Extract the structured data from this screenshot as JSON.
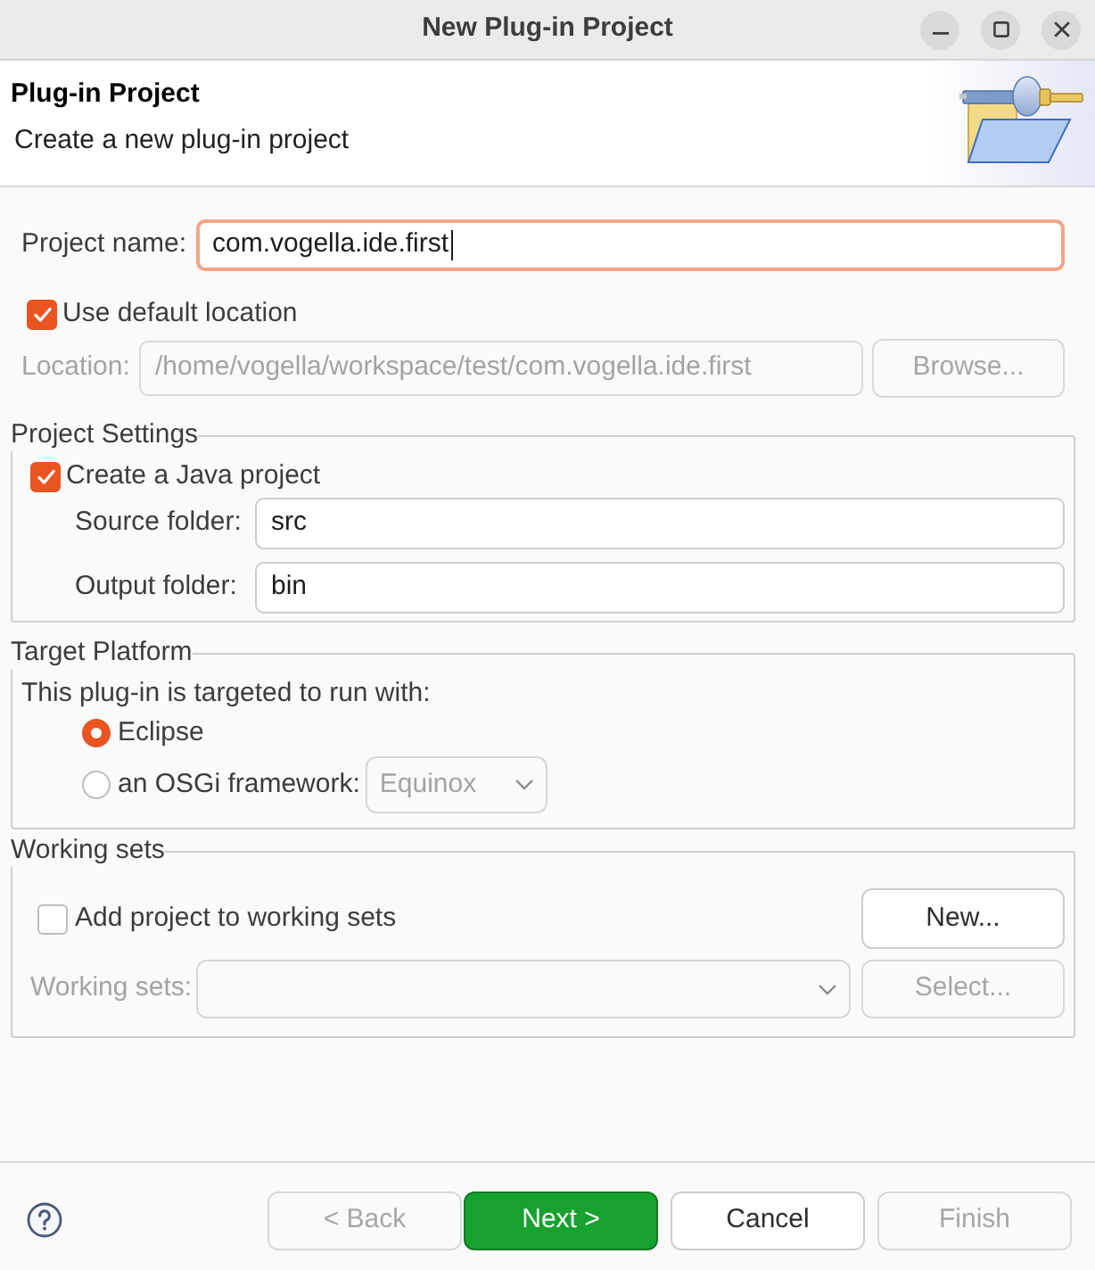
{
  "window": {
    "title": "New Plug-in Project"
  },
  "banner": {
    "title": "Plug-in Project",
    "description": "Create a new plug-in project"
  },
  "project_name": {
    "label": "Project name:",
    "value": "com.vogella.ide.first",
    "focused": true
  },
  "use_default_location": {
    "label": "Use default location",
    "checked": true
  },
  "location": {
    "label": "Location:",
    "value": "/home/vogella/workspace/test/com.vogella.ide.first",
    "disabled": true,
    "browse_button": {
      "label": "Browse...",
      "disabled": true
    }
  },
  "project_settings": {
    "title": "Project Settings",
    "create_java_project": {
      "label": "Create a Java project",
      "checked": true
    },
    "fields": [
      {
        "label": "Source folder:",
        "value": "src"
      },
      {
        "label": "Output folder:",
        "value": "bin"
      }
    ]
  },
  "target_platform": {
    "title": "Target Platform",
    "prompt": "This plug-in is targeted to run with:",
    "options": [
      {
        "label": "Eclipse",
        "selected": true
      },
      {
        "label": "an OSGi framework:",
        "selected": false,
        "select": {
          "value": "Equinox",
          "disabled": true
        }
      }
    ]
  },
  "working_sets": {
    "title": "Working sets",
    "add_to_working_sets": {
      "label": "Add project to working sets",
      "checked": false
    },
    "new_button": {
      "label": "New...",
      "disabled": false
    },
    "working_sets_combo": {
      "label": "Working sets:",
      "disabled": true
    },
    "select_button": {
      "label": "Select...",
      "disabled": true
    }
  },
  "buttons": [
    {
      "label": "< Back",
      "kind": "normal",
      "disabled": true
    },
    {
      "label": "Next >",
      "kind": "default",
      "disabled": false
    },
    {
      "label": "Cancel",
      "kind": "normal",
      "disabled": false
    },
    {
      "label": "Finish",
      "kind": "normal",
      "disabled": true
    }
  ]
}
